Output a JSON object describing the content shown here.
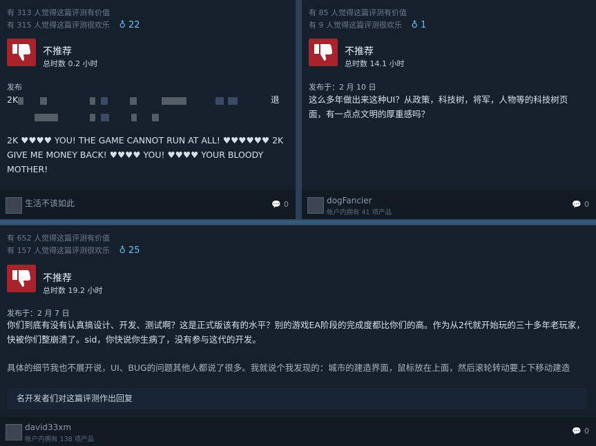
{
  "colors": {
    "accent": "#66c0f4",
    "thumb_down_bg": "#a8232b",
    "card_bg": "#16202d"
  },
  "reviews": [
    {
      "helpful_yes": "有 313 人觉得这篇评测有价值",
      "helpful_funny": "有 315 人觉得这篇评测很欢乐",
      "award_icon": "award-icon",
      "award_count": "22",
      "recommendation": "不推荐",
      "hours": "总时数 0.2 小时",
      "posted": "发布",
      "text_start": "2K",
      "text_end": "退",
      "body": "2K ♥♥♥♥ YOU! THE GAME CANNOT RUN AT ALL! ♥♥♥♥♥♥ 2K GIVE ME MONEY BACK! ♥♥♥♥ YOU! ♥♥♥♥ YOUR BLOODY MOTHER!",
      "user_name": "生活不该如此",
      "user_sub": "",
      "comment_count": "0"
    },
    {
      "helpful_yes": "有 85 人觉得这篇评测有价值",
      "helpful_funny": "有 9 人觉得这篇评测很欢乐",
      "award_icon": "award-icon",
      "award_count": "1",
      "recommendation": "不推荐",
      "hours": "总时数 14.1 小时",
      "posted": "发布于：2 月 10 日",
      "body": "这么多年做出来这种UI？从政策，科技树，将军，人物等的科技树页面，有一点点文明的厚重感吗？",
      "user_name": "dogFancier",
      "user_sub": "帐户内拥有 41 项产品",
      "comment_count": "0"
    },
    {
      "helpful_yes": "有 652 人觉得这篇评测有价值",
      "helpful_funny": "有 157 人觉得这篇评测很欢乐",
      "award_icon": "award-icon",
      "award_count": "25",
      "recommendation": "不推荐",
      "hours": "总时数 19.2 小时",
      "posted": "发布于：2 月 7 日",
      "body": "你们到底有没有认真搞设计、开发、测试啊？这是正式版该有的水平？别的游戏EA阶段的完成度都比你们的高。作为从2代就开始玩的三十多年老玩家，快被你们整崩溃了。sid，你快说你生病了，没有参与这代的开发。",
      "body2": "具体的细节我也不展开说，UI、BUG的问题其他人都说了很多。我就说个我发现的：城市的建造界面，鼠标放在上面，然后滚轮转动要上下移动建造",
      "dev_banner": "名开发者们对这篇评测作出回复",
      "user_name": "david33xm",
      "user_sub": "帐户内拥有 138 项产品",
      "comment_count": "0"
    }
  ]
}
